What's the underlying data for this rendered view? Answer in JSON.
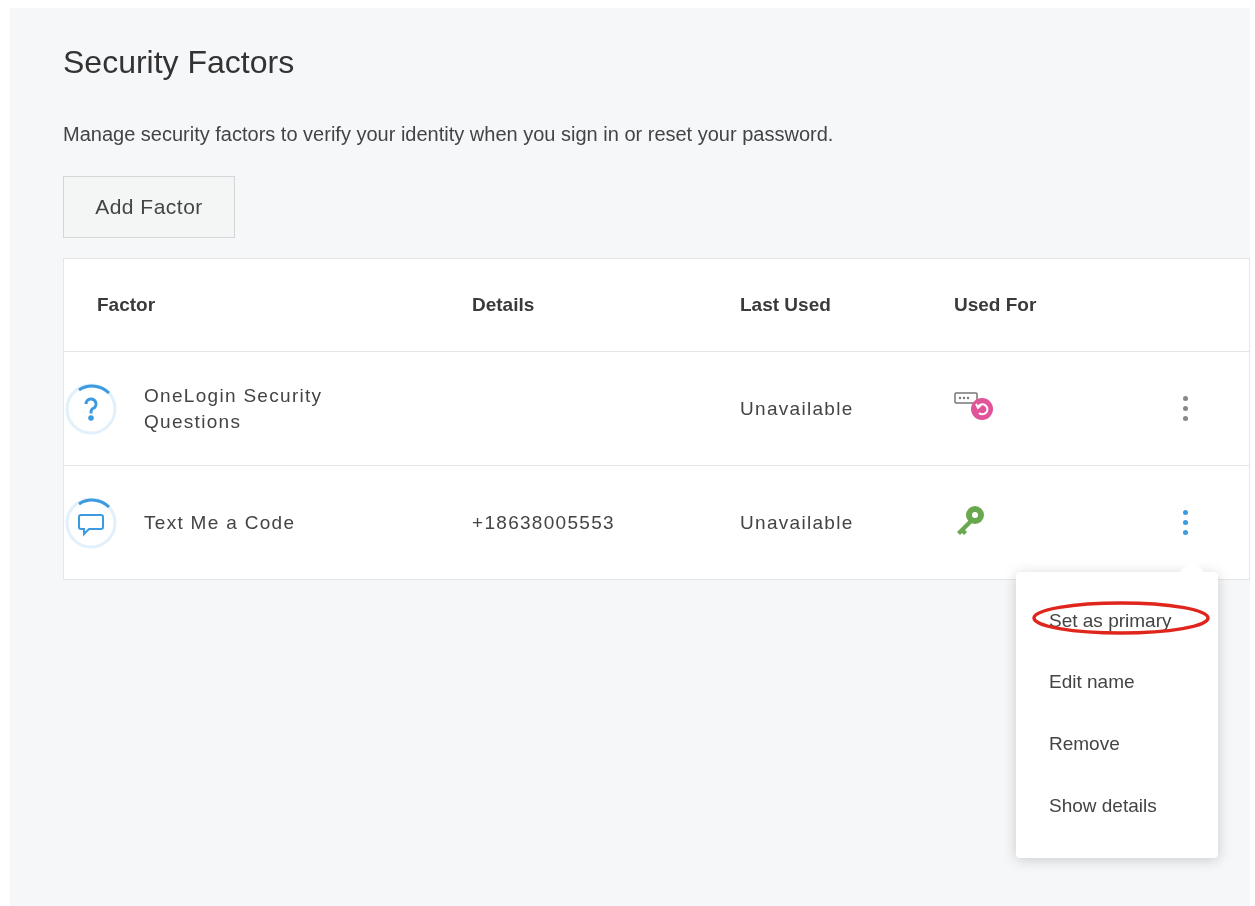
{
  "title": "Security Factors",
  "description": "Manage security factors to verify your identity when you sign in or reset your password.",
  "add_button": "Add Factor",
  "table": {
    "columns": [
      "Factor",
      "Details",
      "Last Used",
      "Used For"
    ],
    "rows": [
      {
        "factor_icon": {
          "kind": "question"
        },
        "factor": "OneLogin Security Questions",
        "last_used": "Unavailable",
        "used_for": {
          "kind": "reset"
        },
        "menu_open": false
      },
      {
        "factor_icon": {
          "kind": "chat"
        },
        "factor": "Text Me a Code",
        "details": "+18638005553",
        "last_used": "Unavailable",
        "used_for": {
          "kind": "key"
        },
        "menu_open": true
      }
    ]
  },
  "menu": {
    "items": [
      {
        "label": "Set as primary",
        "circled": true
      },
      {
        "label": "Edit name",
        "circled": false
      },
      {
        "label": "Remove",
        "circled": false
      },
      {
        "label": "Show details",
        "circled": false
      }
    ]
  }
}
